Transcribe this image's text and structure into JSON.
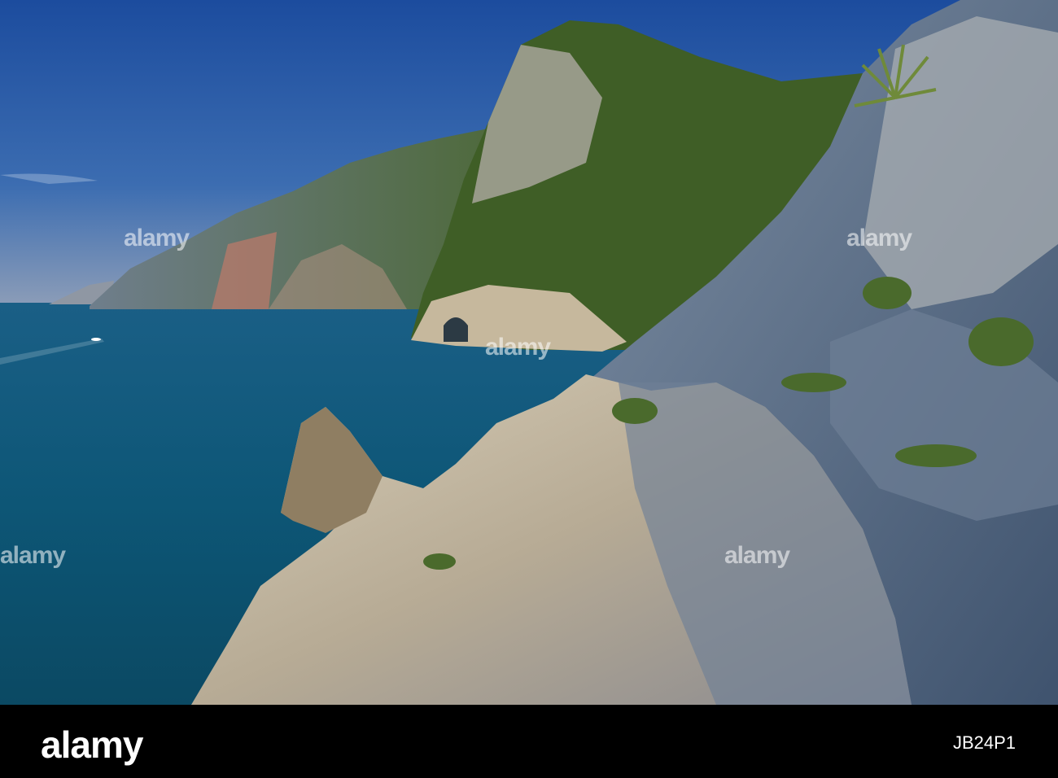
{
  "photo": {
    "subject": "",
    "watermark_text": "alamy"
  },
  "footer": {
    "brand": "alamy",
    "image_id": "JB24P1"
  },
  "colors": {
    "sky_top": "#1f4fa0",
    "sky_bottom": "#6f8fb8",
    "sea": "#0f5a7a",
    "cliff_light": "#c9bca5",
    "cliff_shadow": "#556a84",
    "vegetation": "#3c5a25",
    "footer_bg": "#000000"
  }
}
